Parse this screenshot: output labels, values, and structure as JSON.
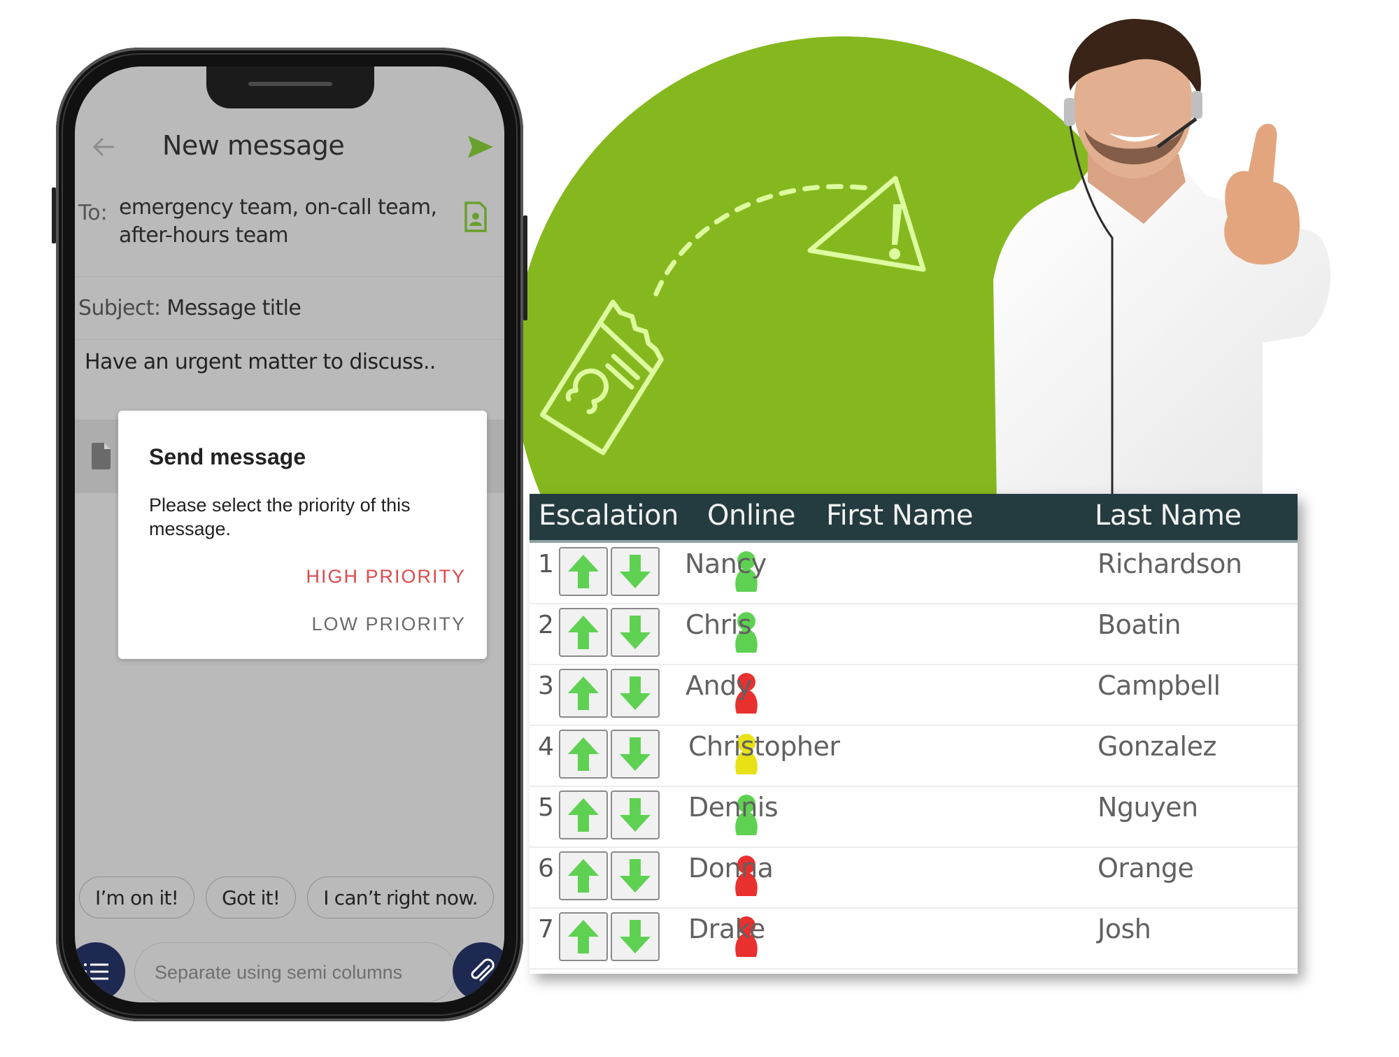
{
  "phone": {
    "header": {
      "title": "New message",
      "back_icon": "arrow-left-icon",
      "send_icon": "send-icon"
    },
    "to": {
      "label": "To:",
      "value": "emergency team, on-call team, after-hours team",
      "contact_icon": "contact-card-icon"
    },
    "subject": {
      "label": "Subject:",
      "value": "Message title"
    },
    "body": "Have an urgent matter to discuss..",
    "attachment_icon": "file-icon",
    "dialog": {
      "title": "Send message",
      "message": "Please select the priority of this message.",
      "high_label": "HIGH PRIORITY",
      "low_label": "LOW PRIORITY",
      "high_color": "#dc4a4e"
    },
    "quick_replies": [
      "I’m on it!",
      "Got it!",
      "I can’t right now."
    ],
    "compose": {
      "placeholder": "Separate using semi columns",
      "menu_icon": "list-icon",
      "attach_icon": "paperclip-icon"
    }
  },
  "theme": {
    "brand_green": "#85b81e",
    "illustration_stroke": "#ddfb9f",
    "table_header_bg": "#243b3f",
    "status_colors": {
      "online": "#5fd152",
      "offline": "#e8302f",
      "away": "#e7e116"
    }
  },
  "table": {
    "columns": [
      "Escalation",
      "Online",
      "First Name",
      "Last Name"
    ],
    "rows": [
      {
        "rank": "1",
        "status": "online",
        "first": "Nancy",
        "last": "Richardson"
      },
      {
        "rank": "2",
        "status": "online",
        "first": "Chris",
        "last": "Boatin"
      },
      {
        "rank": "3",
        "status": "offline",
        "first": "Andy",
        "last": "Campbell"
      },
      {
        "rank": "4",
        "status": "away",
        "first": "Christopher",
        "last": "Gonzalez"
      },
      {
        "rank": "5",
        "status": "online",
        "first": "Dennis",
        "last": "Nguyen"
      },
      {
        "rank": "6",
        "status": "offline",
        "first": "Donna",
        "last": "Orange"
      },
      {
        "rank": "7",
        "status": "offline",
        "first": "Drake",
        "last": "Josh"
      }
    ]
  }
}
